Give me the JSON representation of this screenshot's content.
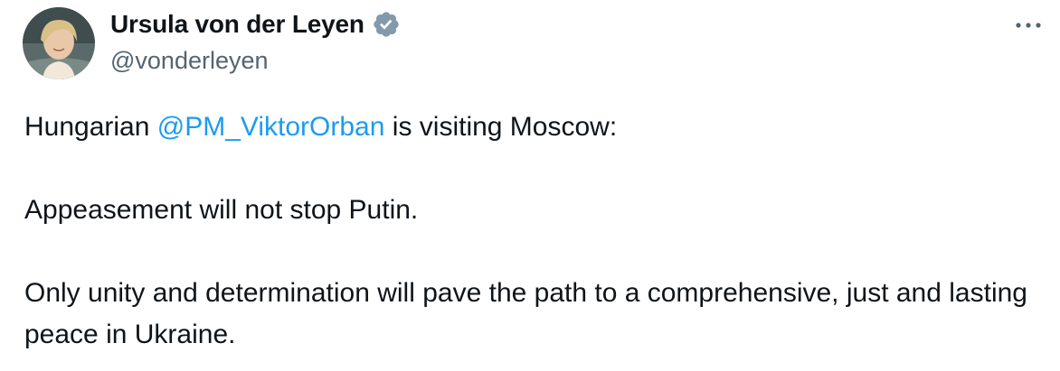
{
  "author": {
    "display_name": "Ursula von der Leyen",
    "handle": "@vonderleyen",
    "verified": true,
    "verified_badge_color": "#829aab",
    "avatar_icon": "profile-photo"
  },
  "menu": {
    "more_icon": "more-horizontal-icon"
  },
  "tweet": {
    "line1_before": "Hungarian ",
    "mention": "@PM_ViktorOrban",
    "line1_after": " is visiting Moscow:",
    "line2": "Appeasement will not stop Putin.",
    "line3": "Only unity and determination will pave the path to a comprehensive, just and lasting peace in Ukraine."
  },
  "colors": {
    "text": "#0f1419",
    "secondary_text": "#536471",
    "link": "#1d9bf0"
  }
}
